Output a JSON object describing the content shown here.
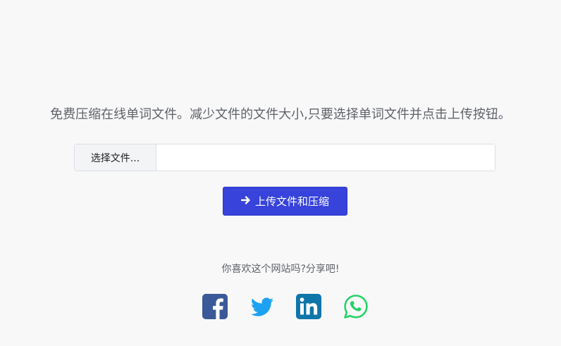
{
  "main": {
    "description": "免费压缩在线单词文件。减少文件的文件大小,只要选择单词文件并点击上传按钮。",
    "file_picker": {
      "choose_label": "选择文件...",
      "path_value": ""
    },
    "upload_button": {
      "label": "上传文件和压缩",
      "icon": "arrow-right-icon",
      "color": "#3743db"
    }
  },
  "share": {
    "prompt": "你喜欢这个网站吗?分享吧!",
    "networks": [
      {
        "name": "facebook",
        "icon": "facebook-icon",
        "color": "#3b5998"
      },
      {
        "name": "twitter",
        "icon": "twitter-icon",
        "color": "#1da1f2"
      },
      {
        "name": "linkedin",
        "icon": "linkedin-icon",
        "color": "#0e76a8"
      },
      {
        "name": "whatsapp",
        "icon": "whatsapp-icon",
        "color": "#25d366"
      }
    ]
  }
}
